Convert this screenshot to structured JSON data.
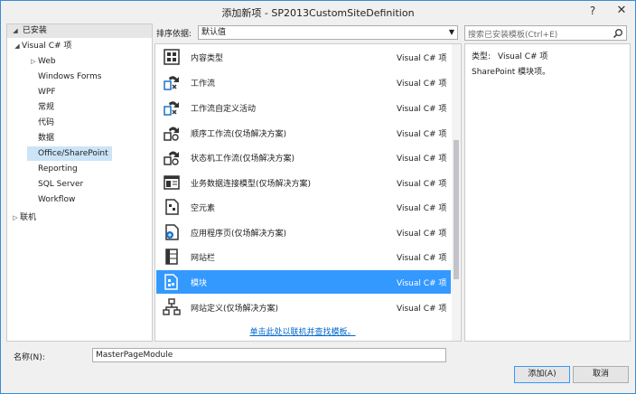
{
  "window": {
    "title": "添加新项 - SP2013CustomSiteDefinition",
    "help": "?",
    "close": "✕"
  },
  "tree": {
    "header": "已安装",
    "nodes": [
      {
        "label": "Visual C# 项",
        "level": 1,
        "arrow": "◢"
      },
      {
        "label": "Web",
        "level": 2,
        "arrow": "▷"
      },
      {
        "label": "Windows Forms",
        "level": 2,
        "arrow": ""
      },
      {
        "label": "WPF",
        "level": 2,
        "arrow": ""
      },
      {
        "label": "常规",
        "level": 2,
        "arrow": ""
      },
      {
        "label": "代码",
        "level": 2,
        "arrow": ""
      },
      {
        "label": "数据",
        "level": 2,
        "arrow": ""
      },
      {
        "label": "Office/SharePoint",
        "level": 2,
        "arrow": "",
        "selected": true
      },
      {
        "label": "Reporting",
        "level": 2,
        "arrow": ""
      },
      {
        "label": "SQL Server",
        "level": 2,
        "arrow": ""
      },
      {
        "label": "Workflow",
        "level": 2,
        "arrow": ""
      },
      {
        "label": "联机",
        "level": 0,
        "arrow": "▷"
      }
    ]
  },
  "sort": {
    "label": "排序依据:",
    "value": "默认值"
  },
  "templates": [
    {
      "name": "内容类型",
      "lang": "Visual C# 项",
      "icon": "content-type-icon"
    },
    {
      "name": "工作流",
      "lang": "Visual C# 项",
      "icon": "workflow-icon"
    },
    {
      "name": "工作流自定义活动",
      "lang": "Visual C# 项",
      "icon": "workflow-activity-icon"
    },
    {
      "name": "顺序工作流(仅场解决方案)",
      "lang": "Visual C# 项",
      "icon": "sequential-workflow-icon"
    },
    {
      "name": "状态机工作流(仅场解决方案)",
      "lang": "Visual C# 项",
      "icon": "state-machine-workflow-icon"
    },
    {
      "name": "业务数据连接模型(仅场解决方案)",
      "lang": "Visual C# 项",
      "icon": "bdc-model-icon"
    },
    {
      "name": "空元素",
      "lang": "Visual C# 项",
      "icon": "empty-element-icon"
    },
    {
      "name": "应用程序页(仅场解决方案)",
      "lang": "Visual C# 项",
      "icon": "application-page-icon"
    },
    {
      "name": "网站栏",
      "lang": "Visual C# 项",
      "icon": "site-column-icon"
    },
    {
      "name": "模块",
      "lang": "Visual C# 项",
      "icon": "module-icon",
      "selected": true
    },
    {
      "name": "网站定义(仅场解决方案)",
      "lang": "Visual C# 项",
      "icon": "site-definition-icon"
    }
  ],
  "online_link": "单击此处以联机并查找模板。",
  "search": {
    "placeholder": "搜索已安装模板(Ctrl+E)"
  },
  "detail": {
    "type_label": "类型:",
    "type_value": "Visual C# 项",
    "description": "SharePoint 模块项。"
  },
  "name_field": {
    "label": "名称(N):",
    "value": "MasterPageModule"
  },
  "buttons": {
    "add": "添加(A)",
    "cancel": "取消"
  },
  "colors": {
    "selection": "#3399ff",
    "tree_selection": "#cce4f7",
    "link": "#0066cc"
  }
}
